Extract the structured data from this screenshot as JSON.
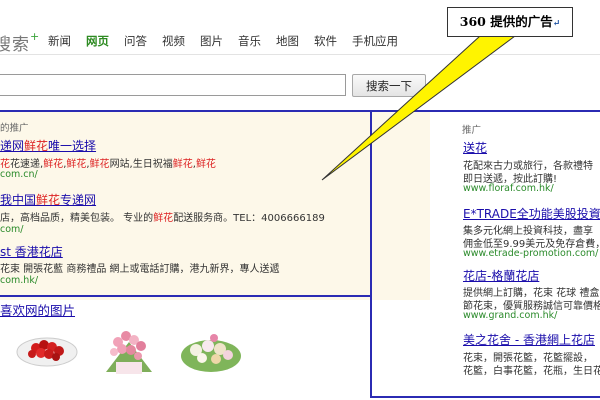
{
  "header": {
    "logo_text": "搜索",
    "logo_plus": "+",
    "nav": [
      "新闻",
      "网页",
      "问答",
      "视频",
      "图片",
      "音乐",
      "地图",
      "软件",
      "手机应用"
    ],
    "active_nav": "网页"
  },
  "search": {
    "query": "",
    "button_label": "搜索一下"
  },
  "callout": {
    "text": "360 提供的广告",
    "glyph": "↵"
  },
  "left_ads": {
    "label": "的推广",
    "items": [
      {
        "title_pre": "递网",
        "title_hl": "鲜花",
        "title_post": "唯一选择",
        "desc": [
          {
            "t": "花",
            "hl": true
          },
          {
            "t": "花速递,",
            "hl": false
          },
          {
            "t": "鲜花",
            "hl": true
          },
          {
            "t": ",",
            "hl": false
          },
          {
            "t": "鲜花",
            "hl": true
          },
          {
            "t": ",",
            "hl": false
          },
          {
            "t": "鲜花",
            "hl": true
          },
          {
            "t": "网站,生日祝福",
            "hl": false
          },
          {
            "t": "鲜花",
            "hl": true
          },
          {
            "t": ",",
            "hl": false
          },
          {
            "t": "鲜花",
            "hl": true
          }
        ],
        "url": "com.cn/"
      },
      {
        "title_pre": "我中国",
        "title_hl": "鲜花",
        "title_post": "专递网",
        "desc": [
          {
            "t": "店，高档品质，精美包装。 专业的",
            "hl": false
          },
          {
            "t": "鲜花",
            "hl": true
          },
          {
            "t": "配送服务商。TEL：4006666189",
            "hl": false
          }
        ],
        "url": "com/"
      },
      {
        "title_pre": "st 香港花店",
        "title_hl": "",
        "title_post": "",
        "desc": [
          {
            "t": "花束  開張花藍  商務禮品  網上或電話訂購，港九新界，專人送遞",
            "hl": false
          }
        ],
        "url": "com.hk/"
      }
    ]
  },
  "right_ads": {
    "label": "推广",
    "items": [
      {
        "title": "送花",
        "desc": [
          "花配來古力或旅行，各款禮特",
          "即日送遞，按此訂購!"
        ],
        "url": "www.floraf.com.hk/"
      },
      {
        "title": "E*TRADE全功能美股投資",
        "desc": [
          "集多元化網上投資科技，盡享",
          "佣金低至9.99美元及免存倉費，"
        ],
        "url": "www.etrade-promotion.com/"
      },
      {
        "title": "花店-格蘭花店",
        "desc": [
          "提供網上訂購，花束 花球 禮盒",
          "節花束，優質服務誠信可靠價格"
        ],
        "url": "www.grand.com.hk/"
      },
      {
        "title": "美之花舍 - 香港網上花店",
        "desc": [
          "花束，開張花籃，花籃擺設，",
          "花籃，白事花籃，花瓶，生日花"
        ],
        "url": ""
      }
    ]
  },
  "images": {
    "title": "喜欢网的图片"
  },
  "colors": {
    "ad_border": "#2b2bb3",
    "link": "#1a0dab",
    "url_green": "#2a8a2a",
    "highlight_red": "#dd2222",
    "callout_fill": "#fff400",
    "ad_bg": "#fdf8e9"
  }
}
